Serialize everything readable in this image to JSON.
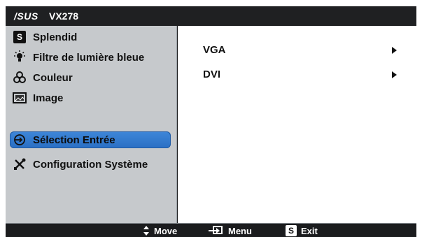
{
  "title": {
    "brand": "/SUS",
    "model": "VX278"
  },
  "menu": {
    "items": [
      {
        "label": "Splendid",
        "icon": "splendid-s-icon"
      },
      {
        "label": "Filtre de lumière bleue",
        "icon": "lightbulb-icon"
      },
      {
        "label": "Couleur",
        "icon": "color-circles-icon"
      },
      {
        "label": "Image",
        "icon": "image-icon"
      },
      {
        "label": "Sélection Entrée",
        "icon": "input-select-icon"
      },
      {
        "label": "Configuration Système",
        "icon": "tools-icon"
      }
    ],
    "active_index": 4
  },
  "submenu": {
    "items": [
      {
        "label": "VGA"
      },
      {
        "label": "DVI"
      }
    ]
  },
  "footer": {
    "move_label": "Move",
    "menu_label": "Menu",
    "exit_label": "Exit",
    "exit_key": "S"
  },
  "colors": {
    "active": "#2f78cc",
    "panel_bg": "#c6c9cc",
    "bar_bg": "#1c1d1f"
  }
}
